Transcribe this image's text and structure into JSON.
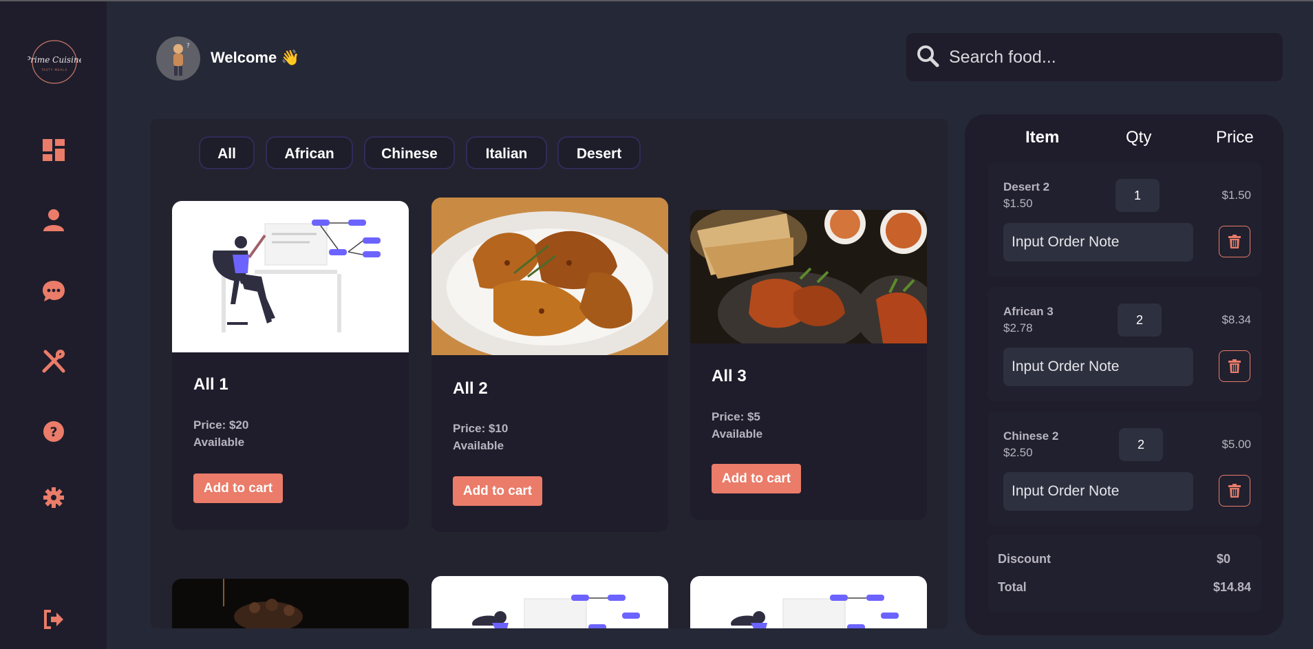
{
  "brand": {
    "logo_text": "Prime Cuisine",
    "logo_sub": "TASTY MEALS",
    "accent": "#ea7c69"
  },
  "sidebar": {
    "items": [
      {
        "icon": "dashboard-icon"
      },
      {
        "icon": "user-icon"
      },
      {
        "icon": "chat-icon"
      },
      {
        "icon": "utensils-icon"
      },
      {
        "icon": "help-icon"
      },
      {
        "icon": "settings-icon"
      },
      {
        "icon": "logout-icon"
      }
    ]
  },
  "header": {
    "welcome": "Welcome 👋",
    "search_placeholder": "Search food..."
  },
  "categories": [
    "All",
    "African",
    "Chinese",
    "Italian",
    "Desert"
  ],
  "products": [
    {
      "title": "All 1",
      "price": "Price: $20",
      "status": "Available",
      "button": "Add to cart"
    },
    {
      "title": "All 2",
      "price": "Price: $10",
      "status": "Available",
      "button": "Add to cart"
    },
    {
      "title": "All 3",
      "price": "Price: $5",
      "status": "Available",
      "button": "Add to cart"
    }
  ],
  "order": {
    "columns": [
      "Item",
      "Qty",
      "Price"
    ],
    "items": [
      {
        "name": "Desert 2",
        "unit_price": "$1.50",
        "qty": "1",
        "total": "$1.50",
        "note_placeholder": "Input Order Note"
      },
      {
        "name": "African 3",
        "unit_price": "$2.78",
        "qty": "2",
        "total": "$8.34",
        "note_placeholder": "Input Order Note"
      },
      {
        "name": "Chinese 2",
        "unit_price": "$2.50",
        "qty": "2",
        "total": "$5.00",
        "note_placeholder": "Input Order Note"
      }
    ],
    "discount_label": "Discount",
    "discount_value": "$0",
    "total_label": "Total",
    "total_value": "$14.84"
  }
}
